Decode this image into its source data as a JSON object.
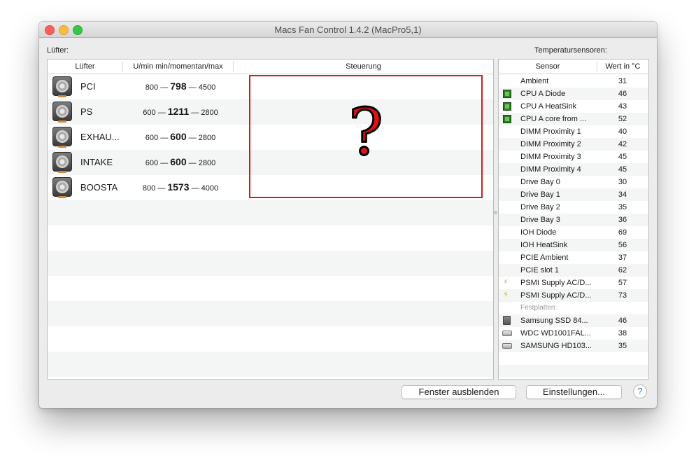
{
  "window": {
    "title": "Macs Fan Control 1.4.2 (MacPro5,1)"
  },
  "labels": {
    "fans": "Lüfter:",
    "sensors": "Temperatursensoren:"
  },
  "fan_table": {
    "headers": [
      "Lüfter",
      "U/min min/momentan/max",
      "Steuerung"
    ],
    "rows": [
      {
        "name": "PCI",
        "min": "800",
        "current": "798",
        "max": "4500"
      },
      {
        "name": "PS",
        "min": "600",
        "current": "1211",
        "max": "2800"
      },
      {
        "name": "EXHAU...",
        "min": "600",
        "current": "600",
        "max": "2800"
      },
      {
        "name": "INTAKE",
        "min": "600",
        "current": "600",
        "max": "2800"
      },
      {
        "name": "BOOSTA",
        "min": "800",
        "current": "1573",
        "max": "4000"
      }
    ],
    "dash": "—",
    "overlay_mark": "?"
  },
  "sensor_table": {
    "headers": [
      "Sensor",
      "Wert in °C"
    ],
    "rows": [
      {
        "name": "Ambient",
        "value": "31",
        "icon": ""
      },
      {
        "name": "CPU A Diode",
        "value": "46",
        "icon": "chip-icon"
      },
      {
        "name": "CPU A HeatSink",
        "value": "43",
        "icon": "chip-icon"
      },
      {
        "name": "CPU A core from ...",
        "value": "52",
        "icon": "chip-icon"
      },
      {
        "name": "DIMM Proximity 1",
        "value": "40",
        "icon": ""
      },
      {
        "name": "DIMM Proximity 2",
        "value": "42",
        "icon": ""
      },
      {
        "name": "DIMM Proximity 3",
        "value": "45",
        "icon": ""
      },
      {
        "name": "DIMM Proximity 4",
        "value": "45",
        "icon": ""
      },
      {
        "name": "Drive Bay 0",
        "value": "30",
        "icon": ""
      },
      {
        "name": "Drive Bay 1",
        "value": "34",
        "icon": ""
      },
      {
        "name": "Drive Bay 2",
        "value": "35",
        "icon": ""
      },
      {
        "name": "Drive Bay 3",
        "value": "36",
        "icon": ""
      },
      {
        "name": "IOH Diode",
        "value": "69",
        "icon": ""
      },
      {
        "name": "IOH HeatSink",
        "value": "56",
        "icon": ""
      },
      {
        "name": "PCIE Ambient",
        "value": "37",
        "icon": ""
      },
      {
        "name": "PCIE slot 1",
        "value": "62",
        "icon": ""
      },
      {
        "name": "PSMI Supply AC/D...",
        "value": "57",
        "icon": "lightning-icon"
      },
      {
        "name": "PSMI Supply AC/D...",
        "value": "73",
        "icon": "lightning-icon"
      }
    ],
    "group_label": "Festplatten:",
    "disks": [
      {
        "name": "Samsung SSD 84...",
        "value": "46",
        "icon": "ssd-icon"
      },
      {
        "name": "WDC WD1001FAL...",
        "value": "38",
        "icon": "hdd-icon"
      },
      {
        "name": "SAMSUNG HD103...",
        "value": "35",
        "icon": "hdd-icon"
      }
    ]
  },
  "buttons": {
    "hide_window": "Fenster ausblenden",
    "settings": "Einstellungen...",
    "help": "?"
  },
  "colors": {
    "highlight_box": "#d21c1c",
    "help_accent": "#2e7ce4"
  }
}
